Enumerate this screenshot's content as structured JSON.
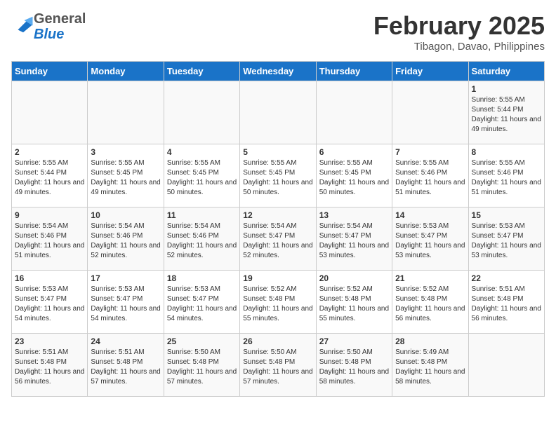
{
  "header": {
    "logo_line1": "General",
    "logo_line2": "Blue",
    "month": "February 2025",
    "location": "Tibagon, Davao, Philippines"
  },
  "days_of_week": [
    "Sunday",
    "Monday",
    "Tuesday",
    "Wednesday",
    "Thursday",
    "Friday",
    "Saturday"
  ],
  "weeks": [
    [
      {
        "num": "",
        "info": ""
      },
      {
        "num": "",
        "info": ""
      },
      {
        "num": "",
        "info": ""
      },
      {
        "num": "",
        "info": ""
      },
      {
        "num": "",
        "info": ""
      },
      {
        "num": "",
        "info": ""
      },
      {
        "num": "1",
        "info": "Sunrise: 5:55 AM\nSunset: 5:44 PM\nDaylight: 11 hours and 49 minutes."
      }
    ],
    [
      {
        "num": "2",
        "info": "Sunrise: 5:55 AM\nSunset: 5:44 PM\nDaylight: 11 hours and 49 minutes."
      },
      {
        "num": "3",
        "info": "Sunrise: 5:55 AM\nSunset: 5:45 PM\nDaylight: 11 hours and 49 minutes."
      },
      {
        "num": "4",
        "info": "Sunrise: 5:55 AM\nSunset: 5:45 PM\nDaylight: 11 hours and 50 minutes."
      },
      {
        "num": "5",
        "info": "Sunrise: 5:55 AM\nSunset: 5:45 PM\nDaylight: 11 hours and 50 minutes."
      },
      {
        "num": "6",
        "info": "Sunrise: 5:55 AM\nSunset: 5:45 PM\nDaylight: 11 hours and 50 minutes."
      },
      {
        "num": "7",
        "info": "Sunrise: 5:55 AM\nSunset: 5:46 PM\nDaylight: 11 hours and 51 minutes."
      },
      {
        "num": "8",
        "info": "Sunrise: 5:55 AM\nSunset: 5:46 PM\nDaylight: 11 hours and 51 minutes."
      }
    ],
    [
      {
        "num": "9",
        "info": "Sunrise: 5:54 AM\nSunset: 5:46 PM\nDaylight: 11 hours and 51 minutes."
      },
      {
        "num": "10",
        "info": "Sunrise: 5:54 AM\nSunset: 5:46 PM\nDaylight: 11 hours and 52 minutes."
      },
      {
        "num": "11",
        "info": "Sunrise: 5:54 AM\nSunset: 5:46 PM\nDaylight: 11 hours and 52 minutes."
      },
      {
        "num": "12",
        "info": "Sunrise: 5:54 AM\nSunset: 5:47 PM\nDaylight: 11 hours and 52 minutes."
      },
      {
        "num": "13",
        "info": "Sunrise: 5:54 AM\nSunset: 5:47 PM\nDaylight: 11 hours and 53 minutes."
      },
      {
        "num": "14",
        "info": "Sunrise: 5:53 AM\nSunset: 5:47 PM\nDaylight: 11 hours and 53 minutes."
      },
      {
        "num": "15",
        "info": "Sunrise: 5:53 AM\nSunset: 5:47 PM\nDaylight: 11 hours and 53 minutes."
      }
    ],
    [
      {
        "num": "16",
        "info": "Sunrise: 5:53 AM\nSunset: 5:47 PM\nDaylight: 11 hours and 54 minutes."
      },
      {
        "num": "17",
        "info": "Sunrise: 5:53 AM\nSunset: 5:47 PM\nDaylight: 11 hours and 54 minutes."
      },
      {
        "num": "18",
        "info": "Sunrise: 5:53 AM\nSunset: 5:47 PM\nDaylight: 11 hours and 54 minutes."
      },
      {
        "num": "19",
        "info": "Sunrise: 5:52 AM\nSunset: 5:48 PM\nDaylight: 11 hours and 55 minutes."
      },
      {
        "num": "20",
        "info": "Sunrise: 5:52 AM\nSunset: 5:48 PM\nDaylight: 11 hours and 55 minutes."
      },
      {
        "num": "21",
        "info": "Sunrise: 5:52 AM\nSunset: 5:48 PM\nDaylight: 11 hours and 56 minutes."
      },
      {
        "num": "22",
        "info": "Sunrise: 5:51 AM\nSunset: 5:48 PM\nDaylight: 11 hours and 56 minutes."
      }
    ],
    [
      {
        "num": "23",
        "info": "Sunrise: 5:51 AM\nSunset: 5:48 PM\nDaylight: 11 hours and 56 minutes."
      },
      {
        "num": "24",
        "info": "Sunrise: 5:51 AM\nSunset: 5:48 PM\nDaylight: 11 hours and 57 minutes."
      },
      {
        "num": "25",
        "info": "Sunrise: 5:50 AM\nSunset: 5:48 PM\nDaylight: 11 hours and 57 minutes."
      },
      {
        "num": "26",
        "info": "Sunrise: 5:50 AM\nSunset: 5:48 PM\nDaylight: 11 hours and 57 minutes."
      },
      {
        "num": "27",
        "info": "Sunrise: 5:50 AM\nSunset: 5:48 PM\nDaylight: 11 hours and 58 minutes."
      },
      {
        "num": "28",
        "info": "Sunrise: 5:49 AM\nSunset: 5:48 PM\nDaylight: 11 hours and 58 minutes."
      },
      {
        "num": "",
        "info": ""
      }
    ]
  ]
}
